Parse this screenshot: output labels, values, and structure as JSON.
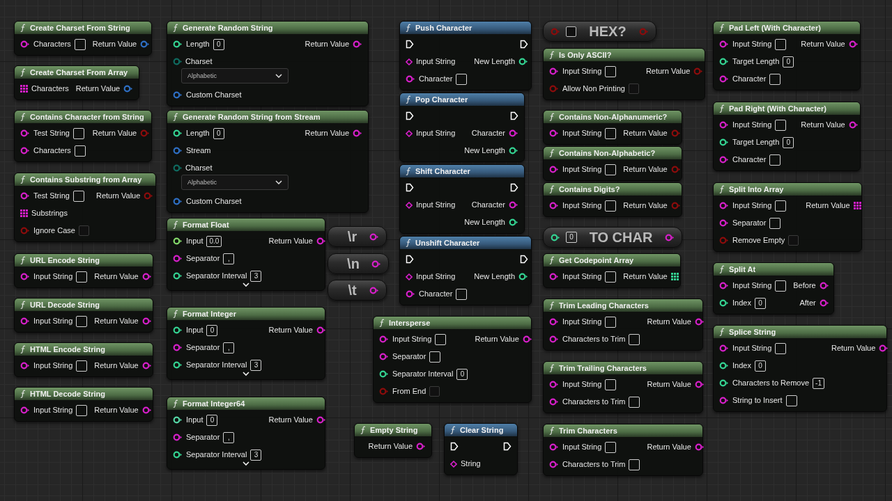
{
  "nodes": [
    {
      "kind": "pure",
      "title": "Create Charset From String",
      "inputs": [
        {
          "label": "Characters",
          "kind": "string",
          "input": {
            "kind": "text"
          }
        }
      ],
      "outputs": [
        {
          "label": "Return Value",
          "kind": "struct"
        }
      ]
    },
    {
      "kind": "pure",
      "title": "Create Charset From Array",
      "inputs": [
        {
          "label": "Characters",
          "kind": "stringarray"
        }
      ],
      "outputs": [
        {
          "label": "Return Value",
          "kind": "struct"
        }
      ]
    },
    {
      "kind": "pure",
      "title": "Contains Character from String",
      "inputs": [
        {
          "label": "Test String",
          "kind": "string",
          "input": {
            "kind": "text"
          }
        },
        {
          "label": "Characters",
          "kind": "string",
          "input": {
            "kind": "text"
          }
        }
      ],
      "outputs": [
        {
          "label": "Return Value",
          "kind": "bool"
        }
      ]
    },
    {
      "kind": "pure",
      "title": "Contains Substring from Array",
      "inputs": [
        {
          "label": "Test String",
          "kind": "string",
          "input": {
            "kind": "text"
          }
        },
        {
          "label": "Substrings",
          "kind": "stringarray"
        },
        {
          "label": "Ignore Case",
          "kind": "bool",
          "input": {
            "kind": "checkbox",
            "checked": false
          }
        }
      ],
      "outputs": [
        {
          "label": "Return Value",
          "kind": "bool"
        }
      ]
    },
    {
      "kind": "pure",
      "title": "URL Encode String",
      "inputs": [
        {
          "label": "Input String",
          "kind": "string",
          "input": {
            "kind": "text"
          }
        }
      ],
      "outputs": [
        {
          "label": "Return Value",
          "kind": "string"
        }
      ]
    },
    {
      "kind": "pure",
      "title": "URL Decode String",
      "inputs": [
        {
          "label": "Input String",
          "kind": "string",
          "input": {
            "kind": "text"
          }
        }
      ],
      "outputs": [
        {
          "label": "Return Value",
          "kind": "string"
        }
      ]
    },
    {
      "kind": "pure",
      "title": "HTML Encode String",
      "inputs": [
        {
          "label": "Input String",
          "kind": "string",
          "input": {
            "kind": "text"
          }
        }
      ],
      "outputs": [
        {
          "label": "Return Value",
          "kind": "string"
        }
      ]
    },
    {
      "kind": "pure",
      "title": "HTML Decode String",
      "inputs": [
        {
          "label": "Input String",
          "kind": "string",
          "input": {
            "kind": "text"
          }
        }
      ],
      "outputs": [
        {
          "label": "Return Value",
          "kind": "string"
        }
      ]
    },
    {
      "kind": "pure",
      "title": "Generate Random String",
      "inputs": [
        {
          "label": "Length",
          "kind": "int",
          "input": {
            "kind": "text",
            "value": "0"
          }
        },
        {
          "label": "Charset",
          "kind": "byte",
          "input": {
            "kind": "dropdown",
            "value": "Alphabetic"
          }
        },
        {
          "label": "Custom Charset",
          "kind": "struct"
        }
      ],
      "outputs": [
        {
          "label": "Return Value",
          "kind": "string"
        }
      ]
    },
    {
      "kind": "pure",
      "title": "Generate Random String from Stream",
      "inputs": [
        {
          "label": "Length",
          "kind": "int",
          "input": {
            "kind": "text",
            "value": "0"
          }
        },
        {
          "label": "Stream",
          "kind": "struct"
        },
        {
          "label": "Charset",
          "kind": "byte",
          "input": {
            "kind": "dropdown",
            "value": "Alphabetic"
          }
        },
        {
          "label": "Custom Charset",
          "kind": "struct"
        }
      ],
      "outputs": [
        {
          "label": "Return Value",
          "kind": "string"
        }
      ]
    },
    {
      "kind": "pure",
      "title": "Format Float",
      "expandable": true,
      "inputs": [
        {
          "label": "Input",
          "kind": "float",
          "input": {
            "kind": "text",
            "value": "0.0"
          }
        },
        {
          "label": "Separator",
          "kind": "string",
          "input": {
            "kind": "text",
            "value": ","
          }
        },
        {
          "label": "Separator Interval",
          "kind": "int",
          "input": {
            "kind": "text",
            "value": "3"
          }
        }
      ],
      "outputs": [
        {
          "label": "Return Value",
          "kind": "string"
        }
      ]
    },
    {
      "kind": "pure",
      "title": "Format Integer",
      "expandable": true,
      "inputs": [
        {
          "label": "Input",
          "kind": "int",
          "input": {
            "kind": "text",
            "value": "0"
          }
        },
        {
          "label": "Separator",
          "kind": "string",
          "input": {
            "kind": "text",
            "value": ","
          }
        },
        {
          "label": "Separator Interval",
          "kind": "int",
          "input": {
            "kind": "text",
            "value": "3"
          }
        }
      ],
      "outputs": [
        {
          "label": "Return Value",
          "kind": "string"
        }
      ]
    },
    {
      "kind": "pure",
      "title": "Format Integer64",
      "expandable": true,
      "inputs": [
        {
          "label": "Input",
          "kind": "int64",
          "input": {
            "kind": "text",
            "value": "0"
          }
        },
        {
          "label": "Separator",
          "kind": "string",
          "input": {
            "kind": "text",
            "value": ","
          }
        },
        {
          "label": "Separator Interval",
          "kind": "int",
          "input": {
            "kind": "text",
            "value": "3"
          }
        }
      ],
      "outputs": [
        {
          "label": "Return Value",
          "kind": "string"
        }
      ]
    },
    {
      "kind": "compact",
      "title": "\\r",
      "outputs": [
        {
          "kind": "string"
        }
      ]
    },
    {
      "kind": "compact",
      "title": "\\n",
      "outputs": [
        {
          "kind": "string"
        }
      ]
    },
    {
      "kind": "compact",
      "title": "\\t",
      "outputs": [
        {
          "kind": "string"
        }
      ]
    },
    {
      "kind": "impure",
      "title": "Push Character",
      "inputs": [
        {
          "kind": "exec"
        },
        {
          "label": "Input String",
          "kind": "stringref"
        },
        {
          "label": "Character",
          "kind": "string",
          "input": {
            "kind": "text"
          }
        }
      ],
      "outputs": [
        {
          "kind": "exec"
        },
        {
          "label": "New Length",
          "kind": "int"
        }
      ]
    },
    {
      "kind": "impure",
      "title": "Pop Character",
      "inputs": [
        {
          "kind": "exec"
        },
        {
          "label": "Input String",
          "kind": "stringref"
        }
      ],
      "outputs": [
        {
          "kind": "exec"
        },
        {
          "label": "Character",
          "kind": "string"
        },
        {
          "label": "New Length",
          "kind": "int"
        }
      ]
    },
    {
      "kind": "impure",
      "title": "Shift Character",
      "inputs": [
        {
          "kind": "exec"
        },
        {
          "label": "Input String",
          "kind": "stringref"
        }
      ],
      "outputs": [
        {
          "kind": "exec"
        },
        {
          "label": "Character",
          "kind": "string"
        },
        {
          "label": "New Length",
          "kind": "int"
        }
      ]
    },
    {
      "kind": "impure",
      "title": "Unshift Character",
      "inputs": [
        {
          "kind": "exec"
        },
        {
          "label": "Input String",
          "kind": "stringref"
        },
        {
          "label": "Character",
          "kind": "string",
          "input": {
            "kind": "text"
          }
        }
      ],
      "outputs": [
        {
          "kind": "exec"
        },
        {
          "label": "New Length",
          "kind": "int"
        }
      ]
    },
    {
      "kind": "pure",
      "title": "Intersperse",
      "inputs": [
        {
          "label": "Input String",
          "kind": "string",
          "input": {
            "kind": "text"
          }
        },
        {
          "label": "Separator",
          "kind": "string",
          "input": {
            "kind": "text"
          }
        },
        {
          "label": "Separator Interval",
          "kind": "int",
          "input": {
            "kind": "text",
            "value": "0"
          }
        },
        {
          "label": "From End",
          "kind": "bool",
          "input": {
            "kind": "checkbox",
            "checked": false
          }
        }
      ],
      "outputs": [
        {
          "label": "Return Value",
          "kind": "string"
        }
      ]
    },
    {
      "kind": "pure",
      "title": "Empty String",
      "outputs": [
        {
          "label": "Return Value",
          "kind": "string"
        }
      ]
    },
    {
      "kind": "impure",
      "title": "Clear String",
      "inputs": [
        {
          "kind": "exec"
        },
        {
          "label": "String",
          "kind": "stringref"
        }
      ],
      "outputs": [
        {
          "kind": "exec"
        }
      ]
    },
    {
      "kind": "compact",
      "title": "HEX?",
      "inputs": [
        {
          "kind": "bool",
          "input": {
            "kind": "checkbox",
            "checked": false
          }
        }
      ],
      "outputs": [
        {
          "kind": "bool"
        }
      ]
    },
    {
      "kind": "pure",
      "title": "Is Only ASCII?",
      "inputs": [
        {
          "label": "Input String",
          "kind": "string",
          "input": {
            "kind": "text"
          }
        },
        {
          "label": "Allow Non Printing",
          "kind": "bool",
          "input": {
            "kind": "checkbox",
            "checked": false
          }
        }
      ],
      "outputs": [
        {
          "label": "Return Value",
          "kind": "bool"
        }
      ]
    },
    {
      "kind": "pure",
      "title": "Contains Non-Alphanumeric?",
      "inputs": [
        {
          "label": "Input String",
          "kind": "string",
          "input": {
            "kind": "text"
          }
        }
      ],
      "outputs": [
        {
          "label": "Return Value",
          "kind": "bool"
        }
      ]
    },
    {
      "kind": "pure",
      "title": "Contains Non-Alphabetic?",
      "inputs": [
        {
          "label": "Input String",
          "kind": "string",
          "input": {
            "kind": "text"
          }
        }
      ],
      "outputs": [
        {
          "label": "Return Value",
          "kind": "bool"
        }
      ]
    },
    {
      "kind": "pure",
      "title": "Contains Digits?",
      "inputs": [
        {
          "label": "Input String",
          "kind": "string",
          "input": {
            "kind": "text"
          }
        }
      ],
      "outputs": [
        {
          "label": "Return Value",
          "kind": "bool"
        }
      ]
    },
    {
      "kind": "compact",
      "title": "TO CHAR",
      "inputs": [
        {
          "kind": "int",
          "input": {
            "kind": "text",
            "value": "0"
          }
        }
      ],
      "outputs": [
        {
          "kind": "string"
        }
      ]
    },
    {
      "kind": "pure",
      "title": "Get Codepoint Array",
      "inputs": [
        {
          "label": "Input String",
          "kind": "string",
          "input": {
            "kind": "text"
          }
        }
      ],
      "outputs": [
        {
          "label": "Return Value",
          "kind": "intarray"
        }
      ]
    },
    {
      "kind": "pure",
      "title": "Trim Leading Characters",
      "inputs": [
        {
          "label": "Input String",
          "kind": "string",
          "input": {
            "kind": "text"
          }
        },
        {
          "label": "Characters to Trim",
          "kind": "string",
          "input": {
            "kind": "text"
          }
        }
      ],
      "outputs": [
        {
          "label": "Return Value",
          "kind": "string"
        }
      ]
    },
    {
      "kind": "pure",
      "title": "Trim Trailing Characters",
      "inputs": [
        {
          "label": "Input String",
          "kind": "string",
          "input": {
            "kind": "text"
          }
        },
        {
          "label": "Characters to Trim",
          "kind": "string",
          "input": {
            "kind": "text"
          }
        }
      ],
      "outputs": [
        {
          "label": "Return Value",
          "kind": "string"
        }
      ]
    },
    {
      "kind": "pure",
      "title": "Trim Characters",
      "inputs": [
        {
          "label": "Input String",
          "kind": "string",
          "input": {
            "kind": "text"
          }
        },
        {
          "label": "Characters to Trim",
          "kind": "string",
          "input": {
            "kind": "text"
          }
        }
      ],
      "outputs": [
        {
          "label": "Return Value",
          "kind": "string"
        }
      ]
    },
    {
      "kind": "pure",
      "title": "Pad Left (With Character)",
      "inputs": [
        {
          "label": "Input String",
          "kind": "string",
          "input": {
            "kind": "text"
          }
        },
        {
          "label": "Target Length",
          "kind": "int",
          "input": {
            "kind": "text",
            "value": "0"
          }
        },
        {
          "label": "Character",
          "kind": "string",
          "input": {
            "kind": "text"
          }
        }
      ],
      "outputs": [
        {
          "label": "Return Value",
          "kind": "string"
        }
      ]
    },
    {
      "kind": "pure",
      "title": "Pad Right (With Character)",
      "inputs": [
        {
          "label": "Input String",
          "kind": "string",
          "input": {
            "kind": "text"
          }
        },
        {
          "label": "Target Length",
          "kind": "int",
          "input": {
            "kind": "text",
            "value": "0"
          }
        },
        {
          "label": "Character",
          "kind": "string",
          "input": {
            "kind": "text"
          }
        }
      ],
      "outputs": [
        {
          "label": "Return Value",
          "kind": "string"
        }
      ]
    },
    {
      "kind": "pure",
      "title": "Split Into Array",
      "inputs": [
        {
          "label": "Input String",
          "kind": "string",
          "input": {
            "kind": "text"
          }
        },
        {
          "label": "Separator",
          "kind": "string",
          "input": {
            "kind": "text"
          }
        },
        {
          "label": "Remove Empty",
          "kind": "bool",
          "input": {
            "kind": "checkbox",
            "checked": false
          }
        }
      ],
      "outputs": [
        {
          "label": "Return Value",
          "kind": "stringarray"
        }
      ]
    },
    {
      "kind": "pure",
      "title": "Split At",
      "inputs": [
        {
          "label": "Input String",
          "kind": "string",
          "input": {
            "kind": "text"
          }
        },
        {
          "label": "Index",
          "kind": "int",
          "input": {
            "kind": "text",
            "value": "0"
          }
        }
      ],
      "outputs": [
        {
          "label": "Before",
          "kind": "string"
        },
        {
          "label": "After",
          "kind": "string"
        }
      ]
    },
    {
      "kind": "pure",
      "title": "Splice String",
      "inputs": [
        {
          "label": "Input String",
          "kind": "string",
          "input": {
            "kind": "text"
          }
        },
        {
          "label": "Index",
          "kind": "int",
          "input": {
            "kind": "text",
            "value": "0"
          }
        },
        {
          "label": "Characters to Remove",
          "kind": "int",
          "input": {
            "kind": "text",
            "value": "-1"
          }
        },
        {
          "label": "String to Insert",
          "kind": "string",
          "input": {
            "kind": "text"
          }
        }
      ],
      "outputs": [
        {
          "label": "Return Value",
          "kind": "string"
        }
      ]
    }
  ]
}
